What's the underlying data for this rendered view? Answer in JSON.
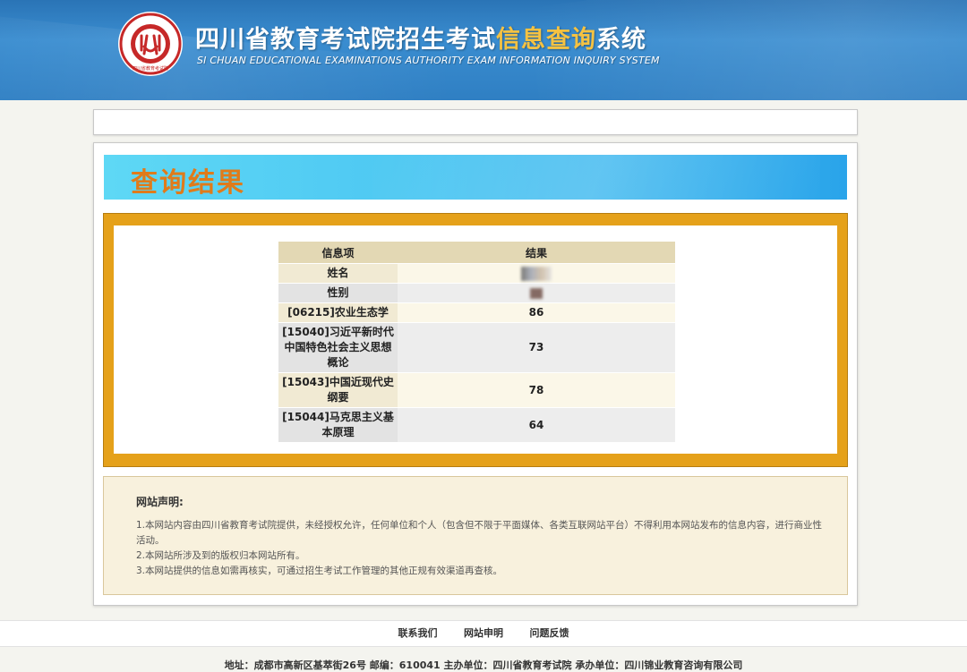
{
  "header": {
    "title_part1": "四川省教育考试院招生考试",
    "title_highlight": "信息查询",
    "title_part2": "系统",
    "subtitle": "SI CHUAN EDUCATIONAL EXAMINATIONS AUTHORITY EXAM INFORMATION INQUIRY SYSTEM",
    "logo_icon": "seal-logo-icon"
  },
  "result_section": {
    "title": "查询结果",
    "columns": [
      "信息项",
      "结果"
    ],
    "rows": [
      {
        "item": "姓名",
        "value": ""
      },
      {
        "item": "性别",
        "value": ""
      },
      {
        "item": "[06215]农业生态学",
        "value": "86"
      },
      {
        "item": "[15040]习近平新时代中国特色社会主义思想概论",
        "value": "73"
      },
      {
        "item": "[15043]中国近现代史纲要",
        "value": "78"
      },
      {
        "item": "[15044]马克思主义基本原理",
        "value": "64"
      }
    ]
  },
  "notice": {
    "title": "网站声明:",
    "lines": [
      "1.本网站内容由四川省教育考试院提供，未经授权允许，任何单位和个人（包含但不限于平面媒体、各类互联网站平台）不得利用本网站发布的信息内容，进行商业性活动。",
      "2.本网站所涉及到的版权归本网站所有。",
      "3.本网站提供的信息如需再核实，可通过招生考试工作管理的其他正规有效渠道再查核。"
    ]
  },
  "footer": {
    "links": [
      "联系我们",
      "网站申明",
      "问题反馈"
    ],
    "info": "地址：成都市高新区基萃街26号 邮编：610041    主办单位：四川省教育考试院 承办单位：四川锦业教育咨询有限公司"
  },
  "colors": {
    "header_blue": "#2f7fc3",
    "title_highlight": "#f5c242",
    "result_title": "#e07b1a",
    "frame_gold": "#e5a11a"
  }
}
